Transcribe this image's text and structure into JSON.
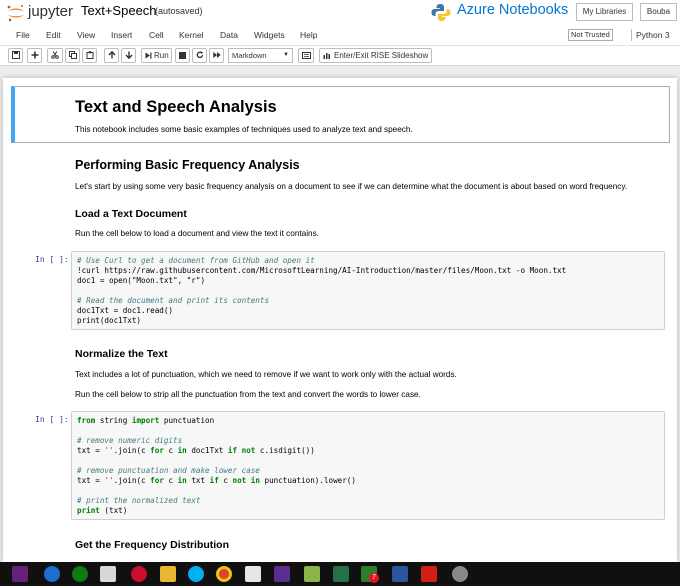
{
  "header": {
    "jupyter_label": "jupyter",
    "notebook_title": "Text+Speech",
    "autosave_status": "(autosaved)",
    "brand_azure": "Azure Notebooks",
    "my_libraries_label": "My Libraries",
    "user_label": "Bouba"
  },
  "menu": {
    "items": [
      "File",
      "Edit",
      "View",
      "Insert",
      "Cell",
      "Kernel",
      "Data",
      "Widgets",
      "Help"
    ],
    "trust_status": "Not Trusted",
    "kernel_name": "Python 3"
  },
  "toolbar": {
    "run_label": "Run",
    "cell_type": "Markdown",
    "rise_label": "Enter/Exit RISE Slideshow"
  },
  "notebook": {
    "title": "Text and Speech Analysis",
    "intro": "This notebook includes some basic examples of techniques used to analyze text and speech.",
    "section1_heading": "Performing Basic Frequency Analysis",
    "section1_text": "Let's start by using some very basic frequency analysis on a document to see if we can determine what the document is about based on word frequency.",
    "load_heading": "Load a Text Document",
    "load_text": "Run the cell below to load a document and view the text it contains.",
    "cell1_prompt": "In [ ]:",
    "cell1_lines": [
      "# Use Curl to get a document from GitHub and open it",
      "!curl https://raw.githubusercontent.com/MicrosoftLearning/AI-Introduction/master/files/Moon.txt -o Moon.txt",
      "doc1 = open(\"Moon.txt\", \"r\")",
      "",
      "# Read the document and print its contents",
      "doc1Txt = doc1.read()",
      "print(doc1Txt)"
    ],
    "normalize_heading": "Normalize the Text",
    "normalize_text1": "Text includes a lot of punctuation, which we need to remove if we want to work only with the actual words.",
    "normalize_text2": "Run the cell below to strip all the punctuation from the text and convert the words to lower case.",
    "cell2_prompt": "In [ ]:",
    "cell2_lines": [
      "from string import punctuation",
      "",
      "# remove numeric digits",
      "txt = ''.join(c for c in doc1Txt if not c.isdigit())",
      "",
      "# remove punctuation and make lower case",
      "txt = ''.join(c for c in txt if c not in punctuation).lower()",
      "",
      "# print the normalized text",
      "print (txt)"
    ],
    "freq_heading": "Get the Frequency Distribution"
  },
  "taskbar": {
    "badge_count": "7",
    "apps": [
      "visual-studio-icon",
      "edge-icon",
      "xbox-icon",
      "mail-icon",
      "antivirus-icon",
      "folder-icon",
      "skype-icon",
      "chrome-icon",
      "media-icon",
      "app-icon",
      "excel-icon",
      "camera-icon",
      "chat-icon",
      "word-icon",
      "acrobat-icon",
      "settings-icon"
    ]
  },
  "colors": {
    "jupyter_orange": "#f37726",
    "azure_blue": "#0078d4",
    "selected_cell_border": "#42a5f5",
    "prompt_color": "#303f9f",
    "comment_color": "#408080",
    "keyword_color": "#008000",
    "string_color": "#ba2121"
  }
}
